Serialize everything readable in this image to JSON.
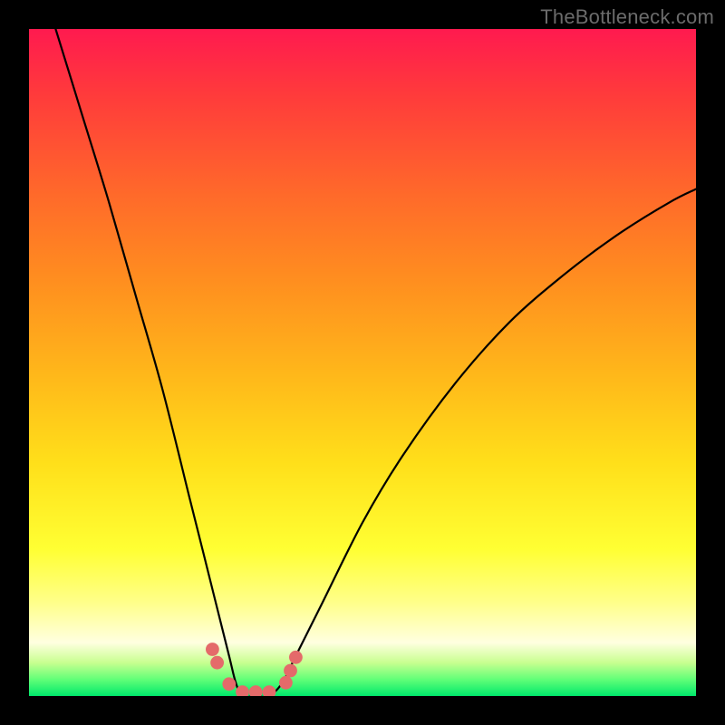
{
  "watermark": "TheBottleneck.com",
  "chart_data": {
    "type": "line",
    "title": "",
    "xlabel": "",
    "ylabel": "",
    "xlim": [
      0,
      100
    ],
    "ylim": [
      0,
      100
    ],
    "grid": false,
    "legend": false,
    "series": [
      {
        "name": "bottleneck-curve",
        "x": [
          4,
          8,
          12,
          16,
          20,
          24,
          26,
          28,
          30,
          31,
          32,
          34,
          36,
          38,
          40,
          44,
          50,
          56,
          64,
          72,
          80,
          88,
          96,
          100
        ],
        "y": [
          100,
          87,
          74,
          60,
          46,
          30,
          22,
          14,
          6,
          2,
          0,
          0,
          0,
          2,
          6,
          14,
          26,
          36,
          47,
          56,
          63,
          69,
          74,
          76
        ]
      }
    ],
    "markers": {
      "name": "bottom-dots",
      "points": [
        {
          "x": 27.5,
          "y": 7.0
        },
        {
          "x": 28.2,
          "y": 5.0
        },
        {
          "x": 30.0,
          "y": 1.8
        },
        {
          "x": 32.0,
          "y": 0.6
        },
        {
          "x": 34.0,
          "y": 0.6
        },
        {
          "x": 36.0,
          "y": 0.6
        },
        {
          "x": 38.5,
          "y": 2.0
        },
        {
          "x": 39.2,
          "y": 3.8
        },
        {
          "x": 40.0,
          "y": 5.8
        }
      ],
      "color": "#e46a6a",
      "radius_pct": 1.0
    },
    "background": {
      "type": "vertical-gradient",
      "stops": [
        {
          "pct": 0,
          "color": "#ff1a4f"
        },
        {
          "pct": 25,
          "color": "#ff6a2a"
        },
        {
          "pct": 52,
          "color": "#ffb81a"
        },
        {
          "pct": 78,
          "color": "#ffff33"
        },
        {
          "pct": 95,
          "color": "#c8ff90"
        },
        {
          "pct": 100,
          "color": "#00e86b"
        }
      ]
    }
  }
}
